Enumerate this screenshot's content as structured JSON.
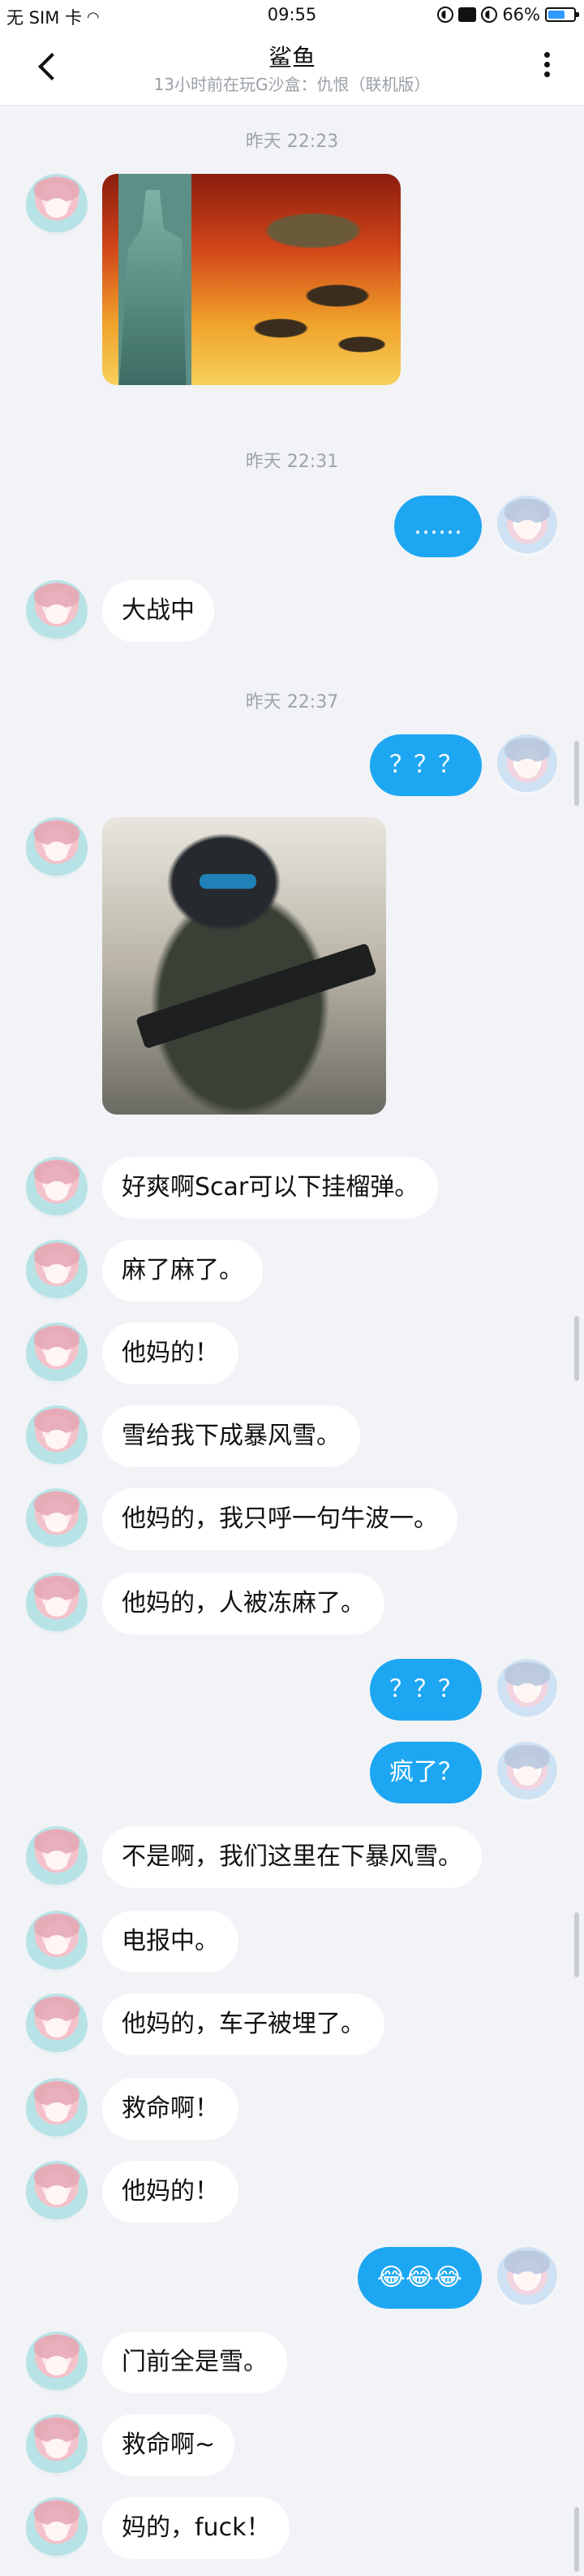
{
  "status_bar": {
    "carrier": "无 SIM 卡",
    "time": "09:55",
    "battery_percent": "66%",
    "battery_level": 0.66,
    "icons": [
      "wifi-icon",
      "circle-status-icon",
      "image-status-icon",
      "lock-rotation-icon",
      "battery-icon"
    ]
  },
  "header": {
    "title": "鲨鱼",
    "subtitle": "13小时前在玩G沙盒：仇恨（联机版）",
    "back_icon": "chevron-left-icon",
    "more_icon": "more-vertical-icon"
  },
  "timestamps": [
    "昨天 22:23",
    "昨天 22:31",
    "昨天 22:37"
  ],
  "messages": [
    {
      "side": "left",
      "type": "image",
      "image_desc": "liberty-statue-airships-image"
    },
    {
      "side": "right",
      "type": "text",
      "text": "……"
    },
    {
      "side": "left",
      "type": "text",
      "text": "大战中"
    },
    {
      "side": "right",
      "type": "text",
      "text": "？？？"
    },
    {
      "side": "left",
      "type": "image",
      "image_desc": "soldier-with-rifle-image"
    },
    {
      "side": "left",
      "type": "text",
      "text": "好爽啊Scar可以下挂榴弹。"
    },
    {
      "side": "left",
      "type": "text",
      "text": "麻了麻了。"
    },
    {
      "side": "left",
      "type": "text",
      "text": "他妈的！"
    },
    {
      "side": "left",
      "type": "text",
      "text": "雪给我下成暴风雪。"
    },
    {
      "side": "left",
      "type": "text",
      "text": "他妈的，我只呼一句牛波一。"
    },
    {
      "side": "left",
      "type": "text",
      "text": "他妈的，人被冻麻了。"
    },
    {
      "side": "right",
      "type": "text",
      "text": "？？？"
    },
    {
      "side": "right",
      "type": "text",
      "text": "疯了？"
    },
    {
      "side": "left",
      "type": "text",
      "text": "不是啊，我们这里在下暴风雪。"
    },
    {
      "side": "left",
      "type": "text",
      "text": "电报中。"
    },
    {
      "side": "left",
      "type": "text",
      "text": "他妈的，车子被埋了。"
    },
    {
      "side": "left",
      "type": "text",
      "text": "救命啊！"
    },
    {
      "side": "left",
      "type": "text",
      "text": "他妈的！"
    },
    {
      "side": "right",
      "type": "text",
      "text": "😂😂😂"
    },
    {
      "side": "left",
      "type": "text",
      "text": "门前全是雪。"
    },
    {
      "side": "left",
      "type": "text",
      "text": "救命啊~"
    },
    {
      "side": "left",
      "type": "text",
      "text": "妈的，fuck！"
    }
  ]
}
